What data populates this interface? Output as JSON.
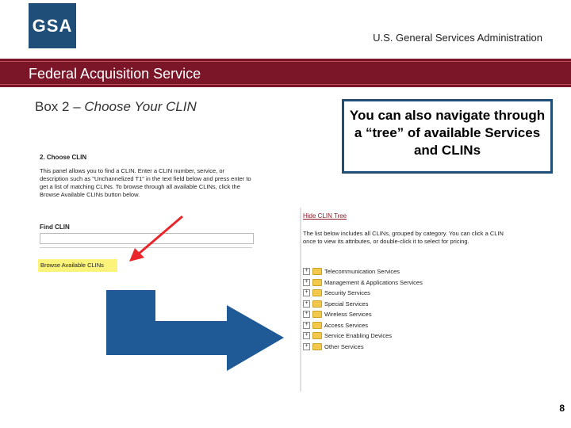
{
  "header": {
    "logo": "GSA",
    "agency": "U.S. General Services Administration"
  },
  "banner": {
    "service": "Federal Acquisition Service"
  },
  "slide": {
    "box_prefix": "Box 2 – ",
    "box_emphasis": "Choose Your CLIN",
    "callout": "You can also navigate through a “tree” of available Services and CLINs",
    "page_number": "8"
  },
  "panel1": {
    "heading": "2. Choose CLIN",
    "description": "This panel allows you to find a CLIN. Enter a CLIN number, service, or description such as \"Unchannelized T1\" in the text field below and press enter to get a list of matching CLINs. To browse through all available CLINs, click the Browse Available CLINs button below.",
    "find_label": "Find CLIN",
    "find_value": "",
    "browse_button": "Browse Available CLINs"
  },
  "panel2": {
    "hide_link": "Hide CLIN Tree",
    "description": "The list below includes all CLINs, grouped by category. You can click a CLIN once to view its attributes, or double-click it to select for pricing.",
    "tree_items": [
      "Telecommunication Services",
      "Management & Applications Services",
      "Security Services",
      "Special Services",
      "Wireless Services",
      "Access Services",
      "Service Enabling Devices",
      "Other Services"
    ]
  },
  "colors": {
    "banner": "#7b1628",
    "logo": "#1f4e79",
    "arrow": "#1f5a96",
    "pointer": "#e8262b",
    "highlight": "#fbf37a"
  }
}
